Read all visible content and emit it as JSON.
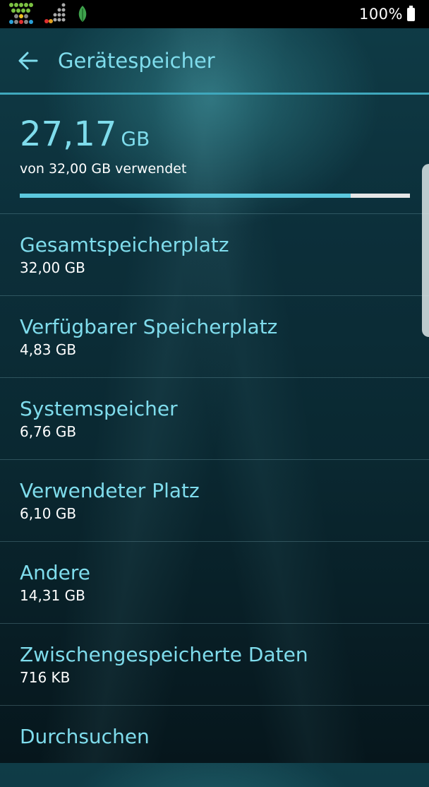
{
  "status_bar": {
    "battery_percent": "100%"
  },
  "header": {
    "title": "Gerätespeicher"
  },
  "summary": {
    "used_value": "27,17",
    "used_unit": "GB",
    "caption": "von 32,00 GB verwendet",
    "used_fraction": 0.849
  },
  "items": [
    {
      "title": "Gesamtspeicherplatz",
      "value": "32,00 GB"
    },
    {
      "title": "Verfügbarer Speicherplatz",
      "value": "4,83 GB"
    },
    {
      "title": "Systemspeicher",
      "value": "6,76 GB"
    },
    {
      "title": "Verwendeter Platz",
      "value": "6,10 GB"
    },
    {
      "title": "Andere",
      "value": "14,31 GB"
    },
    {
      "title": "Zwischengespeicherte Daten",
      "value": "716 KB"
    },
    {
      "title": "Durchsuchen"
    }
  ],
  "colors": {
    "accent": "#7fdcec",
    "progress_fill": "#5cc8de",
    "progress_track": "#e6e6e6"
  },
  "icons": [
    "game-app-icon",
    "signal-strength-icon",
    "leaf-icon",
    "battery-icon",
    "back-arrow-icon"
  ]
}
